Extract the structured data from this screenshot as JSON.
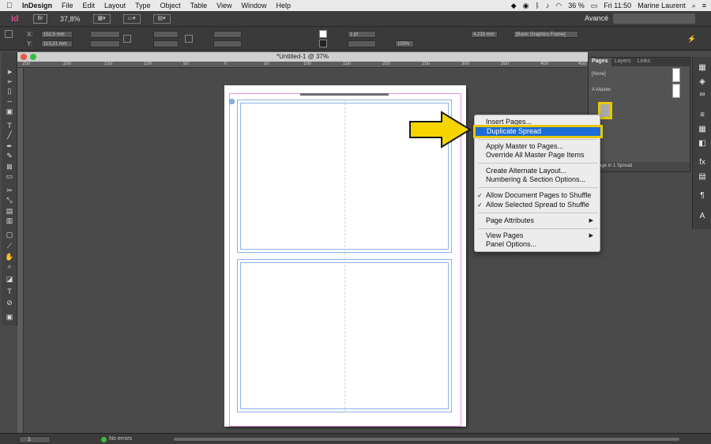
{
  "menubar": {
    "app_name": "InDesign",
    "menus": [
      "File",
      "Edit",
      "Layout",
      "Type",
      "Object",
      "Table",
      "View",
      "Window",
      "Help"
    ],
    "battery": "36 %",
    "clock": "Fri 11:50",
    "user": "Marine Laurent"
  },
  "appbar": {
    "logo": "Id",
    "bridge": "Br",
    "zoom": "37,8%",
    "workspace": "Avancé"
  },
  "control": {
    "x_label": "X:",
    "y_label": "Y:",
    "x_value": "152,5 mm",
    "y_value": "113,21 mm",
    "stroke_weight": "1 pt",
    "opacity": "100%",
    "ref_value": "4,233 mm",
    "style_value": "[Basic Graphics Frame]"
  },
  "document": {
    "title": "*Untitled-1 @ 37%",
    "ruler_ticks": [
      "250",
      "200",
      "150",
      "100",
      "50",
      "0",
      "50",
      "100",
      "150",
      "200",
      "250",
      "300",
      "350",
      "400",
      "450"
    ]
  },
  "pages_panel": {
    "tabs": [
      "Pages",
      "Layers",
      "Links"
    ],
    "none_label": "[None]",
    "master_label": "A-Master",
    "footer_text": "1 Page in 1 Spread"
  },
  "context_menu": {
    "items": [
      {
        "label": "Insert Pages...",
        "check": "",
        "submenu": ""
      },
      {
        "label": "Duplicate Spread",
        "check": "",
        "submenu": ""
      },
      {
        "label": "Apply Master to Pages...",
        "check": "",
        "submenu": ""
      },
      {
        "label": "Override All Master Page Items",
        "check": "",
        "submenu": ""
      },
      {
        "label": "Create Alternate Layout...",
        "check": "",
        "submenu": ""
      },
      {
        "label": "Numbering & Section Options...",
        "check": "",
        "submenu": ""
      },
      {
        "label": "Allow Document Pages to Shuffle",
        "check": "✓",
        "submenu": ""
      },
      {
        "label": "Allow Selected Spread to Shuffle",
        "check": "✓",
        "submenu": ""
      },
      {
        "label": "Page Attributes",
        "check": "",
        "submenu": "▶"
      },
      {
        "label": "View Pages",
        "check": "",
        "submenu": "▶"
      },
      {
        "label": "Panel Options...",
        "check": "",
        "submenu": ""
      }
    ]
  },
  "statusbar": {
    "page_number": "1",
    "errors": "No errors"
  },
  "colors": {
    "highlight": "#1c6ed6",
    "annotation_yellow": "#e7c800",
    "indesign_pink": "#cc4f8f"
  },
  "icons": {
    "arrow": "pointer-arrow-icon"
  }
}
